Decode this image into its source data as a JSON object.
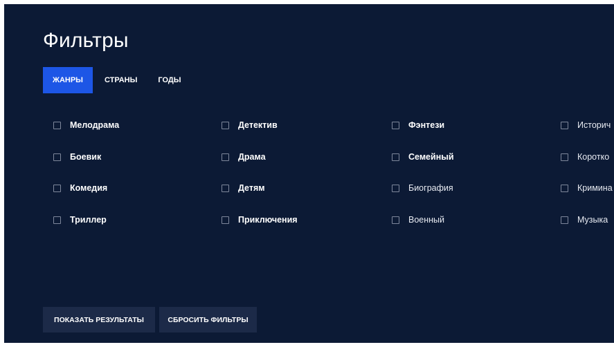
{
  "title": "Фильтры",
  "tabs": [
    {
      "label": "ЖАНРЫ",
      "active": true
    },
    {
      "label": "СТРАНЫ",
      "active": false
    },
    {
      "label": "ГОДЫ",
      "active": false
    }
  ],
  "genres": {
    "columns": [
      [
        {
          "label": "Мелодрама",
          "checked": false
        },
        {
          "label": "Боевик",
          "checked": false
        },
        {
          "label": "Комедия",
          "checked": false
        },
        {
          "label": "Триллер",
          "checked": false
        }
      ],
      [
        {
          "label": "Детектив",
          "checked": false
        },
        {
          "label": "Драма",
          "checked": false
        },
        {
          "label": "Детям",
          "checked": false
        },
        {
          "label": "Приключения",
          "checked": false
        }
      ],
      [
        {
          "label": "Фэнтези",
          "checked": false
        },
        {
          "label": "Семейный",
          "checked": false
        },
        {
          "label": "Биография",
          "checked": false
        },
        {
          "label": "Военный",
          "checked": false
        }
      ],
      [
        {
          "label": "Историч",
          "checked": false
        },
        {
          "label": "Коротко",
          "checked": false
        },
        {
          "label": "Кримина",
          "checked": false
        },
        {
          "label": "Музыка",
          "checked": false
        }
      ]
    ]
  },
  "buttons": {
    "show_results": "ПОКАЗАТЬ РЕЗУЛЬТАТЫ",
    "reset_filters": "СБРОСИТЬ ФИЛЬТРЫ"
  },
  "colors": {
    "background": "#0c1a35",
    "accent": "#1d56e6",
    "button_bg": "#1c2a48",
    "checkbox_border": "#7f889c"
  }
}
